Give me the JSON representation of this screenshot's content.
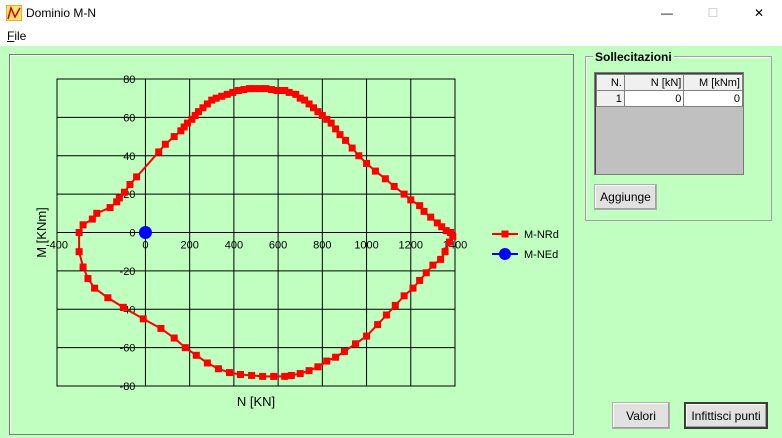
{
  "window": {
    "title": "Dominio M-N",
    "minimize_glyph": "—",
    "maximize_glyph": "☐",
    "close_glyph": "✕",
    "icon": "chart-triangle-icon"
  },
  "menu": {
    "file_mnemonic": "F",
    "file_rest": "ile"
  },
  "sollecitazioni": {
    "title": "Sollecitazioni",
    "columns": [
      "N.",
      "N [kN]",
      "M [kNm]"
    ],
    "rows": [
      [
        "1",
        "0",
        "0"
      ]
    ],
    "add_button": "Aggiunge"
  },
  "buttons": {
    "valori": "Valori",
    "infittisci": "Infittisci punti"
  },
  "chart_data": {
    "type": "scatter",
    "xlabel": "N [KN]",
    "ylabel": "M [KNm]",
    "xlim": [
      -400,
      1400
    ],
    "ylim": [
      -80,
      80
    ],
    "xticks": [
      -400,
      0,
      200,
      400,
      600,
      800,
      1000,
      1200,
      1400
    ],
    "yticks": [
      -80,
      -60,
      -40,
      -20,
      0,
      20,
      40,
      60,
      80
    ],
    "xtick_labels": [
      "-400",
      "0",
      "200",
      "400",
      "600",
      "800",
      "1000",
      "1200",
      "1400"
    ],
    "ytick_labels": [
      "-80",
      "-60",
      "-40",
      "-20",
      "0",
      "20",
      "40",
      "60",
      "80"
    ],
    "grid": true,
    "legend_position": "right",
    "series": [
      {
        "name": "M-NRd",
        "color": "#ff0000",
        "marker": "square",
        "x": [
          -300,
          -282,
          -240,
          -220,
          -160,
          -130,
          -118,
          -95,
          -70,
          -40,
          60,
          90,
          130,
          160,
          175,
          190,
          210,
          225,
          240,
          260,
          280,
          300,
          320,
          345,
          370,
          395,
          420,
          445,
          470,
          495,
          520,
          545,
          570,
          595,
          620,
          630,
          650,
          680,
          700,
          720,
          740,
          760,
          780,
          800,
          820,
          840,
          860,
          880,
          905,
          935,
          965,
          1000,
          1040,
          1085,
          1125,
          1170,
          1200,
          1240,
          1260,
          1290,
          1320,
          1340,
          1360,
          1380,
          1390,
          1375,
          1355,
          1335,
          1300,
          1270,
          1240,
          1210,
          1170,
          1130,
          1090,
          1050,
          1000,
          950,
          900,
          860,
          820,
          780,
          740,
          700,
          660,
          630,
          580,
          530,
          480,
          430,
          380,
          330,
          280,
          230,
          180,
          130,
          70,
          -10,
          -100,
          -170,
          -230,
          -260,
          -282,
          -300
        ],
        "y": [
          0,
          4,
          7,
          10,
          13,
          16,
          18,
          21,
          25,
          29,
          42,
          46,
          50,
          53,
          55,
          57,
          59,
          61,
          63,
          65,
          67,
          69,
          70,
          71,
          72,
          73,
          74,
          74.5,
          75,
          75,
          75,
          75,
          74.5,
          74,
          74,
          74,
          73,
          72,
          70,
          69,
          67,
          65,
          63,
          61,
          59,
          57,
          54,
          51,
          48,
          44,
          40,
          36,
          32,
          28,
          24,
          20,
          17,
          14,
          11,
          8,
          5,
          3,
          1,
          0,
          -2,
          -5,
          -10,
          -14,
          -17,
          -21,
          -25,
          -29,
          -33,
          -38,
          -43,
          -48,
          -54,
          -58,
          -62,
          -65,
          -67,
          -70,
          -72,
          -73.5,
          -74.5,
          -75,
          -75,
          -75,
          -74.5,
          -74,
          -73,
          -71,
          -68,
          -64,
          -60,
          -55,
          -50,
          -45,
          -39,
          -34,
          -29,
          -24,
          -18,
          -10
        ]
      },
      {
        "name": "M-NEd",
        "color": "#0000ff",
        "marker": "circle",
        "x": [
          0
        ],
        "y": [
          0
        ]
      }
    ]
  }
}
